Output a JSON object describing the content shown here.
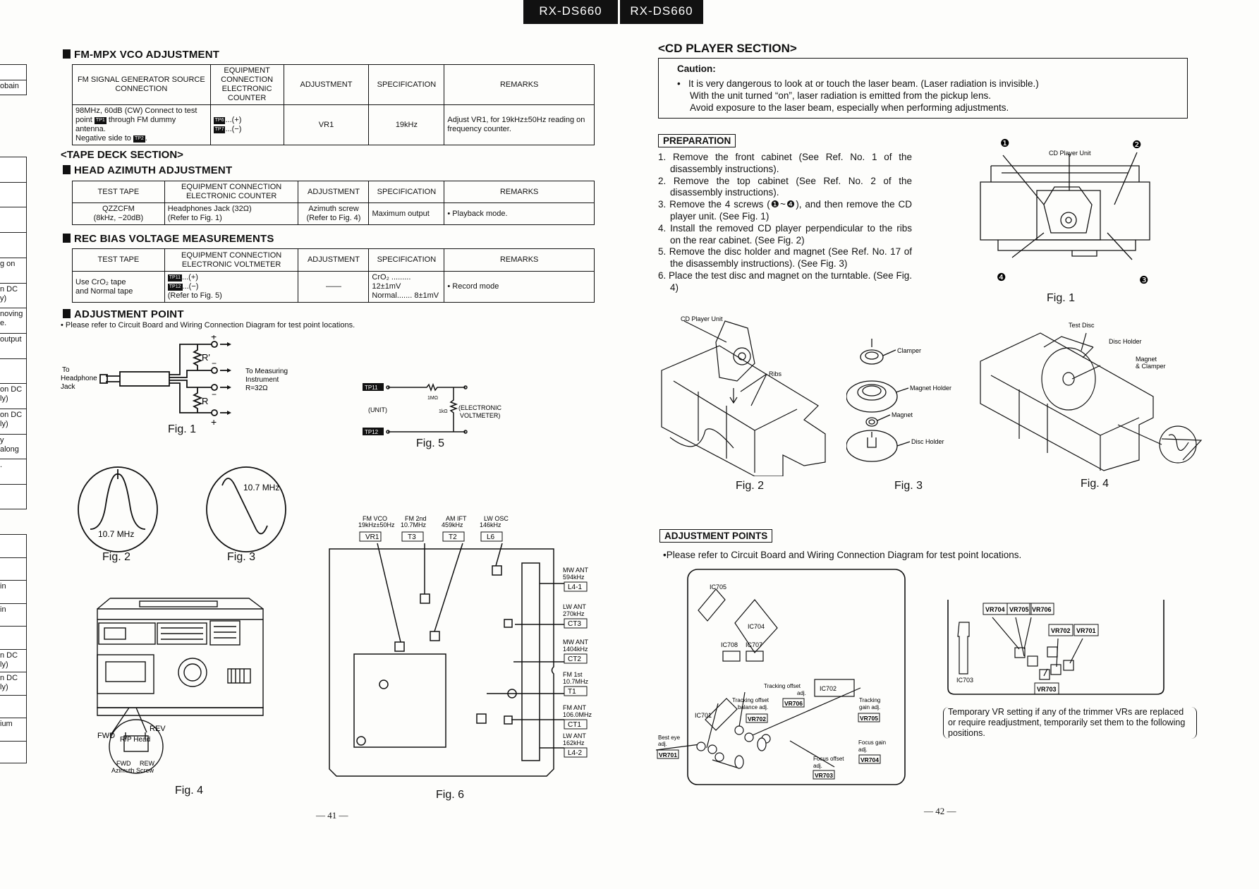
{
  "header": {
    "model_left": "RX-DS660",
    "model_right": "RX-DS660"
  },
  "left_strip": {
    "upper": [
      "",
      "obain"
    ],
    "middle": [
      "",
      "",
      "",
      "",
      "g on",
      "n DC\ny)",
      "noving\ne.",
      "output",
      "",
      "on DC\nly)",
      "on DC\nly)",
      "y\nalong",
      ".",
      ""
    ],
    "lower": [
      "",
      "",
      "in",
      "in",
      "",
      "n DC\nly)",
      "n DC\nly)",
      "",
      "ium",
      ""
    ]
  },
  "fm_mpx": {
    "heading": "FM-MPX VCO ADJUSTMENT",
    "headers": [
      "FM SIGNAL GENERATOR SOURCE CONNECTION",
      "EQUIPMENT CONNECTION ELECTRONIC COUNTER",
      "ADJUSTMENT",
      "SPECIFICATION",
      "REMARKS"
    ],
    "row": {
      "source_1": "98MHz, 60dB (CW) Connect to test point",
      "tp1": "TP1",
      "source_2": "through FM dummy antenna.",
      "source_3": "Negative side to",
      "tp2": "TP2",
      "tp6": "TP6",
      "plus": "...(+)",
      "tp7": "TP7",
      "minus": "...(−)",
      "adjustment": "VR1",
      "specification": "19kHz",
      "remarks": "Adjust VR1, for 19kHz±50Hz reading on frequency counter."
    }
  },
  "tape_deck": {
    "section_title": "<TAPE DECK SECTION>",
    "head_azimuth": {
      "heading": "HEAD AZIMUTH ADJUSTMENT",
      "headers": [
        "TEST TAPE",
        "EQUIPMENT CONNECTION ELECTRONIC COUNTER",
        "ADJUSTMENT",
        "SPECIFICATION",
        "REMARKS"
      ],
      "row": [
        "QZZCFM\n(8kHz, −20dB)",
        "Headphones Jack (32Ω)\n(Refer to Fig. 1)",
        "Azimuth screw\n(Refer to Fig. 4)",
        "Maximum output",
        "• Playback mode."
      ]
    },
    "rec_bias": {
      "heading": "REC BIAS VOLTAGE MEASUREMENTS",
      "headers": [
        "TEST TAPE",
        "EQUIPMENT CONNECTION ELECTRONIC VOLTMETER",
        "ADJUSTMENT",
        "SPECIFICATION",
        "REMARKS"
      ],
      "test_tape": "Use CrO₂ tape\nand Normal tape",
      "tp11": "TP11",
      "plus": "...(+)",
      "tp12": "TP12",
      "minus": "...(−)",
      "refer": "(Refer to Fig. 5)",
      "adjustment": "——",
      "spec_1": "CrO₂ ......... 12±1mV",
      "spec_2": "Normal....... 8±1mV",
      "remarks": "• Record mode"
    },
    "adjustment_point": {
      "heading": "ADJUSTMENT POINT",
      "note": "• Please refer to Circuit Board and Wiring Connection Diagram for test point locations."
    }
  },
  "fig1_left": {
    "to": "To",
    "headphone": "Headphone",
    "jack": "Jack",
    "r_prime": "R'",
    "r": "R",
    "plus": "+",
    "minus": "−",
    "measuring_1": "To Measuring",
    "measuring_2": "Instrument",
    "measuring_3": "R=32Ω",
    "label": "Fig. 1"
  },
  "fig5": {
    "tp11": "TP11",
    "tp12": "TP12",
    "r1": "1MΩ",
    "r2": "1kΩ",
    "unit": "(UNIT)",
    "voltmeter_1": "(ELECTRONIC",
    "voltmeter_2": "VOLTMETER)",
    "label": "Fig. 5"
  },
  "fig2_left": {
    "freq": "10.7 MHz",
    "label": "Fig. 2"
  },
  "fig3_left": {
    "freq": "10.7 MHz",
    "label": "Fig. 3"
  },
  "fig4_left": {
    "fwd": "FWD",
    "rev": "REV",
    "rp_head": "R/P Head",
    "fwd2": "FWD",
    "rew": "REW",
    "azimuth": "Azimuth Screw",
    "label": "Fig. 4"
  },
  "fig6": {
    "top": [
      {
        "name": "FM VCO",
        "value": "19kHz±50Hz",
        "part": "VR1"
      },
      {
        "name": "FM 2nd",
        "value": "10.7MHz",
        "part": "T3"
      },
      {
        "name": "AM IFT",
        "value": "459kHz",
        "part": "T2"
      },
      {
        "name": "LW OSC",
        "value": "146kHz",
        "part": "L6"
      }
    ],
    "side": [
      {
        "name": "MW ANT",
        "value": "594kHz",
        "part": "L4-1"
      },
      {
        "name": "LW ANT",
        "value": "270kHz",
        "part": "CT3"
      },
      {
        "name": "MW ANT",
        "value": "1404kHz",
        "part": "CT2"
      },
      {
        "name": "FM 1st",
        "value": "10.7MHz",
        "part": "T1"
      },
      {
        "name": "FM ANT",
        "value": "106.0MHz",
        "part": "CT1"
      },
      {
        "name": "LW ANT",
        "value": "162kHz",
        "part": "L4-2"
      }
    ],
    "label": "Fig. 6"
  },
  "page_numbers": {
    "left": "— 41 —",
    "right": "— 42 —"
  },
  "cd": {
    "section_title": "<CD PLAYER SECTION>",
    "caution": {
      "title": "Caution:",
      "line1": "It is very dangerous to look at or touch the laser beam.   (Laser radiation is invisible.)",
      "line2": "With the unit turned “on”, laser radiation is emitted from the pickup lens.",
      "line3": "Avoid exposure to the laser beam, especially when performing adjustments."
    },
    "preparation": {
      "title": "PREPARATION",
      "steps": [
        "1. Remove the front cabinet (See Ref. No. 1 of the disassembly instructions).",
        "2. Remove the top cabinet (See Ref. No. 2 of the disassembly instructions).",
        "3. Remove the 4 screws (❶~❹), and then remove the CD player unit. (See Fig. 1)",
        "4. Install the removed CD player perpendicular to the ribs on the rear cabinet. (See Fig. 2)",
        "5. Remove the disc holder and magnet (See Ref. No. 17 of the disassembly instructions). (See Fig. 3)",
        "6. Place the test disc and magnet on the turntable. (See Fig. 4)"
      ]
    },
    "fig1": {
      "unit": "CD Player Unit",
      "s1": "❶",
      "s2": "❷",
      "s3": "❸",
      "s4": "❹",
      "label": "Fig. 1"
    },
    "fig2": {
      "unit": "CD Player Unit",
      "ribs": "Ribs",
      "label": "Fig. 2"
    },
    "fig3": {
      "clamper": "Clamper",
      "magnet_holder": "Magnet Holder",
      "magnet": "Magnet",
      "disc_holder": "Disc Holder",
      "label": "Fig. 3"
    },
    "fig4": {
      "test_disc": "Test Disc",
      "disc_holder": "Disc Holder",
      "magnet_1": "Magnet",
      "magnet_2": "& Clamper",
      "label": "Fig. 4"
    },
    "adjustment_points": {
      "title": "ADJUSTMENT POINTS",
      "note": "•Please refer to Circuit Board and Wiring Connection Diagram for test point locations.",
      "board": {
        "ic705": "IC705",
        "ic704": "IC704",
        "ic708": "IC708",
        "ic707": "IC707",
        "ic702": "IC702",
        "ic701": "IC701",
        "tracking_offset_1": "Tracking offset",
        "tracking_offset_2": "adj.",
        "tob_1": "Tracking offset",
        "tob_2": "balance adj.",
        "tgain_1": "Tracking",
        "tgain_2": "gain adj.",
        "best_eye_1": "Best eye",
        "best_eye_2": "adj.",
        "focus_gain_1": "Focus gain",
        "focus_gain_2": "adj.",
        "focus_offset_1": "Focus offset",
        "focus_offset_2": "adj.",
        "vr701": "VR701",
        "vr702": "VR702",
        "vr703": "VR703",
        "vr704": "VR704",
        "vr705": "VR705",
        "vr706": "VR706"
      },
      "temp": {
        "vr704": "VR704",
        "vr705": "VR705",
        "vr706": "VR706",
        "vr702": "VR702",
        "vr701": "VR701",
        "vr703": "VR703",
        "ic703": "IC703"
      },
      "temporary_note": "Temporary VR setting if any of the trimmer VRs are replaced or require readjustment, temporarily set them to the following positions."
    }
  }
}
